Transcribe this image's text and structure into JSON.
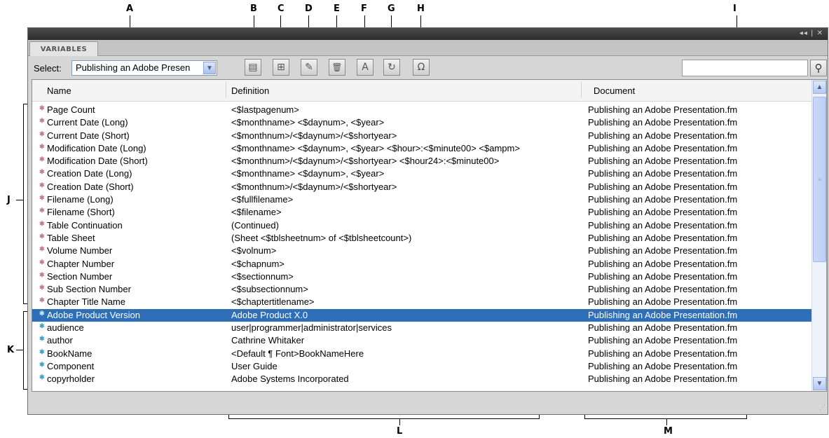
{
  "callouts": {
    "a": "A",
    "b": "B",
    "c": "C",
    "d": "D",
    "e": "E",
    "f": "F",
    "g": "G",
    "h": "H",
    "i": "I",
    "j": "J",
    "k": "K",
    "l": "L",
    "m": "M"
  },
  "panel": {
    "tab_label": "VARIABLES",
    "title_controls": "◂◂ | ✕",
    "select_label": "Select:",
    "select_value": "Publishing an Adobe Presen",
    "search_placeholder": ""
  },
  "toolbar": [
    {
      "name": "create-variable-icon",
      "glyph": "▤"
    },
    {
      "name": "insert-variable-icon",
      "glyph": "⊞"
    },
    {
      "name": "edit-variable-icon",
      "glyph": "✎"
    },
    {
      "name": "delete-variable-icon",
      "glyph": "🗑"
    },
    {
      "name": "convert-to-text-icon",
      "glyph": "A"
    },
    {
      "name": "update-variables-icon",
      "glyph": "↻"
    },
    {
      "name": "import-variables-icon",
      "glyph": "Ω"
    }
  ],
  "columns": [
    "Name",
    "Definition",
    "Document"
  ],
  "rows": [
    {
      "type": "sys",
      "name": "Page Count",
      "definition": "<$lastpagenum>",
      "document": "Publishing an Adobe Presentation.fm"
    },
    {
      "type": "sys",
      "name": "Current Date (Long)",
      "definition": "<$monthname> <$daynum>, <$year>",
      "document": "Publishing an Adobe Presentation.fm"
    },
    {
      "type": "sys",
      "name": "Current Date (Short)",
      "definition": "<$monthnum>/<$daynum>/<$shortyear>",
      "document": "Publishing an Adobe Presentation.fm"
    },
    {
      "type": "sys",
      "name": "Modification Date (Long)",
      "definition": "<$monthname> <$daynum>, <$year> <$hour>:<$minute00> <$ampm>",
      "document": "Publishing an Adobe Presentation.fm"
    },
    {
      "type": "sys",
      "name": "Modification Date (Short)",
      "definition": "<$monthnum>/<$daynum>/<$shortyear> <$hour24>:<$minute00>",
      "document": "Publishing an Adobe Presentation.fm"
    },
    {
      "type": "sys",
      "name": "Creation Date (Long)",
      "definition": "<$monthname> <$daynum>, <$year>",
      "document": "Publishing an Adobe Presentation.fm"
    },
    {
      "type": "sys",
      "name": "Creation Date (Short)",
      "definition": "<$monthnum>/<$daynum>/<$shortyear>",
      "document": "Publishing an Adobe Presentation.fm"
    },
    {
      "type": "sys",
      "name": "Filename (Long)",
      "definition": "<$fullfilename>",
      "document": "Publishing an Adobe Presentation.fm"
    },
    {
      "type": "sys",
      "name": "Filename (Short)",
      "definition": "<$filename>",
      "document": "Publishing an Adobe Presentation.fm"
    },
    {
      "type": "sys",
      "name": "Table Continuation",
      "definition": "(Continued)",
      "document": "Publishing an Adobe Presentation.fm"
    },
    {
      "type": "sys",
      "name": "Table Sheet",
      "definition": "(Sheet <$tblsheetnum> of <$tblsheetcount>)",
      "document": "Publishing an Adobe Presentation.fm"
    },
    {
      "type": "sys",
      "name": "Volume Number",
      "definition": "<$volnum>",
      "document": "Publishing an Adobe Presentation.fm"
    },
    {
      "type": "sys",
      "name": "Chapter Number",
      "definition": "<$chapnum>",
      "document": "Publishing an Adobe Presentation.fm"
    },
    {
      "type": "sys",
      "name": "Section Number",
      "definition": "<$sectionnum>",
      "document": "Publishing an Adobe Presentation.fm"
    },
    {
      "type": "sys",
      "name": "Sub Section Number",
      "definition": "<$subsectionnum>",
      "document": "Publishing an Adobe Presentation.fm"
    },
    {
      "type": "sys",
      "name": "Chapter Title Name",
      "definition": "<$chaptertitlename>",
      "document": "Publishing an Adobe Presentation.fm"
    },
    {
      "type": "usr",
      "selected": true,
      "name": "Adobe Product Version",
      "definition": "Adobe Product X.0",
      "document": "Publishing an Adobe Presentation.fm"
    },
    {
      "type": "usr",
      "name": "audience",
      "definition": "user|programmer|administrator|services",
      "document": "Publishing an Adobe Presentation.fm"
    },
    {
      "type": "usr",
      "name": "author",
      "definition": "Cathrine Whitaker",
      "document": "Publishing an Adobe Presentation.fm"
    },
    {
      "type": "usr",
      "name": "BookName",
      "definition": "<Default ¶ Font>BookNameHere",
      "document": "Publishing an Adobe Presentation.fm"
    },
    {
      "type": "usr",
      "name": "Component",
      "definition": "User Guide",
      "document": "Publishing an Adobe Presentation.fm"
    },
    {
      "type": "usr",
      "name": "copyrholder",
      "definition": "Adobe Systems Incorporated",
      "document": "Publishing an Adobe Presentation.fm"
    }
  ],
  "colors": {
    "selection": "#2f6fb7",
    "system_icon": "#c27b8e",
    "user_icon": "#3aa3c9"
  }
}
